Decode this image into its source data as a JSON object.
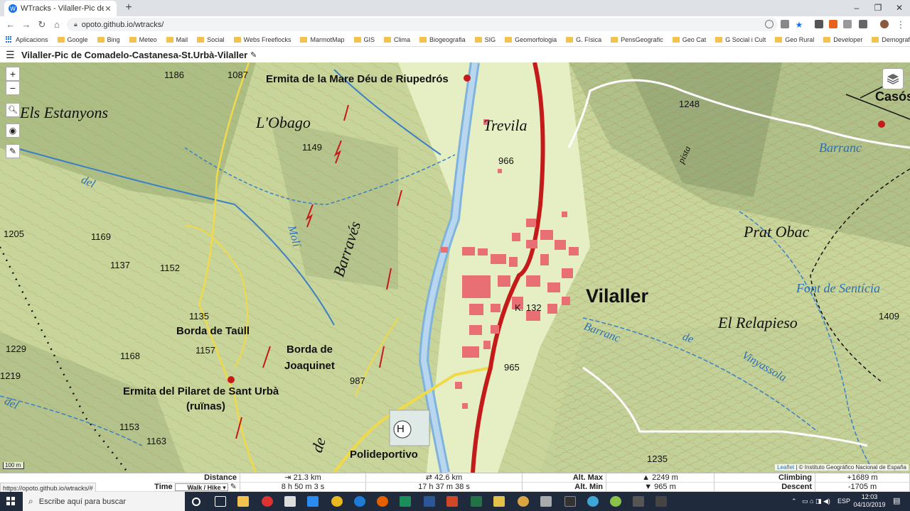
{
  "browser": {
    "tab_title": "WTracks - Vilaller-Pic de Comadelo",
    "tab_close": "✕",
    "new_tab": "+",
    "url": "opoto.github.io/wtracks/",
    "window_controls": [
      "–",
      "❐",
      "✕"
    ]
  },
  "bookmarks": [
    "Aplicacions",
    "Google",
    "Bing",
    "Meteo",
    "Mail",
    "Social",
    "Webs Freeflocks",
    "MarmotMap",
    "GIS",
    "Clima",
    "Biogeografia",
    "SIG",
    "Geomorfologia",
    "G. Física",
    "PensGeografic",
    "Geo Cat",
    "G Social i Cult",
    "Geo Rural",
    "Developer",
    "Demografia"
  ],
  "app": {
    "track_title": "Vilaller-Pic de Comadelo-Castanesa-St.Urbà-Vilaller"
  },
  "map": {
    "controls": {
      "zoom_in": "+",
      "zoom_out": "−"
    },
    "scale": "100 m",
    "attribution_leaflet": "Leaflet",
    "attribution_rest": " | © Instituto Geográfico Nacional de España",
    "labels": {
      "estanyons": "Els Estanyons",
      "obago": "L'Obago",
      "ermita_riupedros": "Ermita de la Mare Déu de Riupedrós",
      "trevila": "Trevila",
      "caso": "Casós",
      "prat_obac": "Prat Obac",
      "vilaller": "Vilaller",
      "relapieso": "El Relapieso",
      "font_senticia": "Font de Sentícia",
      "barranc_top": "Barranc",
      "pista": "pista",
      "borda_taull": "Borda de Taüll",
      "borda_joaquinet_1": "Borda de",
      "borda_joaquinet_2": "Joaquinet",
      "ermita_pilaret_1": "Ermita del Pilaret de Sant Urbà",
      "ermita_pilaret_2": "(ruïnas)",
      "poliesportivo": "Polideportivo",
      "km": "K. 132",
      "h": "H",
      "moli": "Molí",
      "barraves": "Barravés",
      "del_left": "del",
      "del_left2": "del",
      "de_bottom": "de",
      "barranc_mid": "Barranc",
      "de_mid": "de",
      "vinyassola": "Vinyassola"
    },
    "elevations": {
      "e1186": "1186",
      "e1087": "1087",
      "e1149": "1149",
      "e966": "966",
      "e1248": "1248",
      "e1205": "1205",
      "e1169": "1169",
      "e1137": "1137",
      "e1152": "1152",
      "e1135": "1135",
      "e1157": "1157",
      "e1229": "1229",
      "e1168": "1168",
      "e1219": "1219",
      "e987": "987",
      "e965": "965",
      "e1153": "1153",
      "e1163": "1163",
      "e1409": "1409",
      "e1235": "1235"
    }
  },
  "stats": {
    "distance_label": "Distance",
    "distance_one_way": "⇥ 21.3 km",
    "distance_round": "⇄ 42.6 km",
    "altmax_label": "Alt. Max",
    "altmax_value": "▲ 2249 m",
    "climbing_label": "Climbing",
    "climbing_value": "+1689 m",
    "time_label": "Time",
    "activity": "Walk / Hike",
    "time_one_way": "8 h 50 m 3 s",
    "time_round": "17 h 37 m 38 s",
    "altmin_label": "Alt. Min",
    "altmin_value": "▼ 965 m",
    "descent_label": "Descent",
    "descent_value": "-1705 m",
    "status_url": "https://opoto.github.io/wtracks/#"
  },
  "taskbar": {
    "search_placeholder": "Escribe aquí para buscar",
    "language": "ESP",
    "time": "12:03",
    "date": "04/10/2019"
  }
}
